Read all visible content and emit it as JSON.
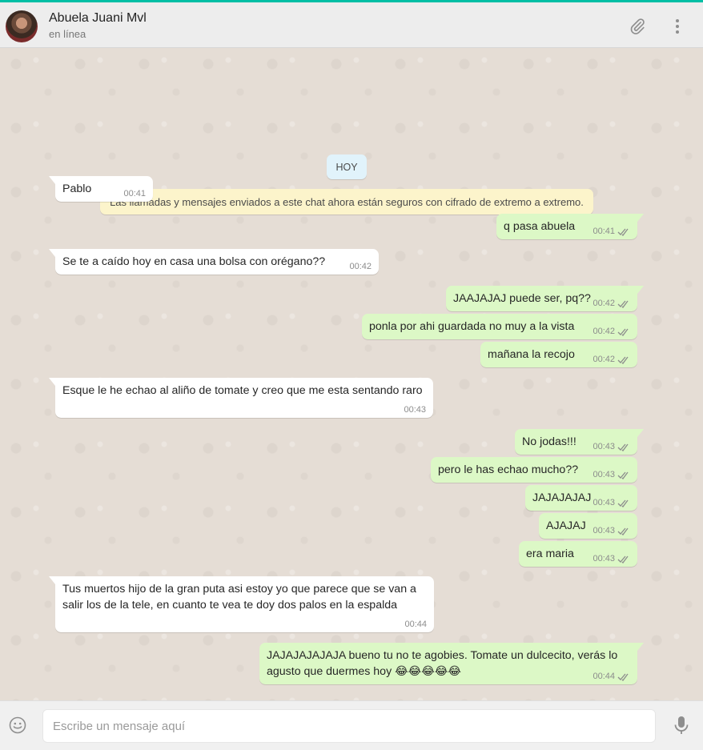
{
  "header": {
    "contact_name": "Abuela Juani Mvl",
    "status": "en línea"
  },
  "icons": {
    "attach": "paperclip-icon",
    "menu": "more-vertical-icon",
    "emoji": "smiley-icon",
    "mic": "microphone-icon"
  },
  "colors": {
    "accent": "#00bfa5",
    "incoming_bubble": "#ffffff",
    "outgoing_bubble": "#dcf8c6",
    "read_ticks": "#8c8c8c"
  },
  "chat": {
    "date_label": "HOY",
    "encryption_notice": "Las llamadas y mensajes enviados a este chat ahora están seguros con cifrado de extremo a extremo.",
    "messages": [
      {
        "dir": "in",
        "text": "Pablo",
        "time": "00:41"
      },
      {
        "dir": "out",
        "text": "q pasa abuela",
        "time": "00:41"
      },
      {
        "dir": "in",
        "text": "Se te a caído hoy en casa una bolsa con orégano??",
        "time": "00:42"
      },
      {
        "dir": "out",
        "text": "JAAJAJAJ puede ser, pq??",
        "time": "00:42"
      },
      {
        "dir": "out",
        "text": "ponla por ahi guardada no muy a la vista",
        "time": "00:42"
      },
      {
        "dir": "out",
        "text": "mañana la recojo",
        "time": "00:42"
      },
      {
        "dir": "in",
        "text": "Esque le he echao al aliño de tomate y creo que me esta sentando raro",
        "time": "00:43"
      },
      {
        "dir": "out",
        "text": "No jodas!!!",
        "time": "00:43"
      },
      {
        "dir": "out",
        "text": "pero le has echao mucho??",
        "time": "00:43"
      },
      {
        "dir": "out",
        "text": "JAJAJAJAJ",
        "time": "00:43"
      },
      {
        "dir": "out",
        "text": "AJAJAJ",
        "time": "00:43"
      },
      {
        "dir": "out",
        "text": "era maria",
        "time": "00:43"
      },
      {
        "dir": "in",
        "text": "Tus muertos hijo de la gran puta asi estoy yo que parece que se van a salir los de la tele, en cuanto te vea te doy dos palos en la espalda",
        "time": "00:44"
      },
      {
        "dir": "out",
        "text": "JAJAJAJAJAJA bueno tu no te agobies. Tomate un dulcecito, verás lo agusto que duermes hoy 😂😂😂😂😂",
        "time": "00:44"
      }
    ]
  },
  "composer": {
    "placeholder": "Escribe un mensaje aquí"
  }
}
